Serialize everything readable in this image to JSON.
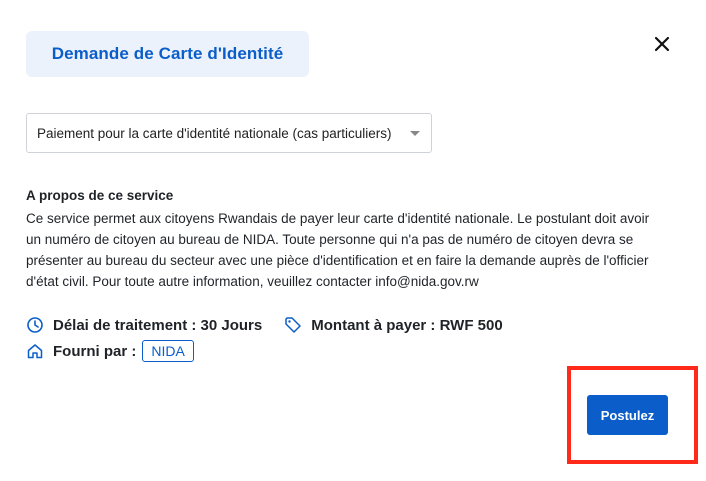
{
  "header": {
    "title": "Demande de Carte d'Identité",
    "close_icon": "close-icon"
  },
  "service_select": {
    "value": "Paiement pour la carte d'identité nationale (cas particuliers)"
  },
  "about": {
    "heading": "A propos de ce service",
    "body": "Ce service permet aux citoyens Rwandais de payer leur carte d'identité nationale. Le postulant doit avoir un numéro de citoyen au bureau de NIDA. Toute personne qui n'a pas de numéro de citoyen devra se présenter au bureau du secteur avec une pièce d'identification et en faire la demande auprès de l'officier d'état civil. Pour toute autre information, veuillez contacter info@nida.gov.rw"
  },
  "meta": {
    "processing_time": "Délai de traitement : 30 Jours",
    "amount": "Montant à payer : RWF 500",
    "provider_label": "Fourni par :",
    "provider_value": "NIDA"
  },
  "actions": {
    "apply_label": "Postulez"
  },
  "colors": {
    "accent": "#0b5ec9",
    "title_bg": "#ecf2fb",
    "highlight": "#ff2a1a"
  }
}
